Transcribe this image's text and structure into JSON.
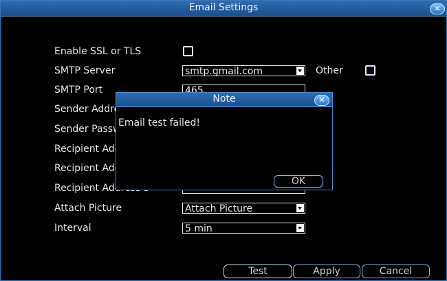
{
  "window": {
    "title": "Email Settings"
  },
  "form": {
    "ssl_label": "Enable SSL or TLS",
    "smtp_server_label": "SMTP Server",
    "smtp_server_value": "smtp.gmail.com",
    "other_label": "Other",
    "smtp_port_label": "SMTP Port",
    "smtp_port_value": "465",
    "sender_address_label": "Sender Addres",
    "sender_password_label": "Sender Passwo",
    "recipient1_label": "Recipient Add",
    "recipient2_label": "Recipient Add",
    "recipient3_label": "Recipient Address 3",
    "attach_label": "Attach Picture",
    "attach_value": "Attach Picture",
    "interval_label": "Interval",
    "interval_value": "5 min"
  },
  "buttons": {
    "test": "Test",
    "apply": "Apply",
    "cancel": "Cancel"
  },
  "note": {
    "title": "Note",
    "message": "Email test failed!",
    "ok": "OK"
  },
  "icons": {
    "close": "close-icon",
    "dropdown": "chevron-down-icon"
  },
  "colors": {
    "titlebar": "#2f6db0",
    "border": "#3a78b8",
    "button_border": "#7fb6ee"
  }
}
